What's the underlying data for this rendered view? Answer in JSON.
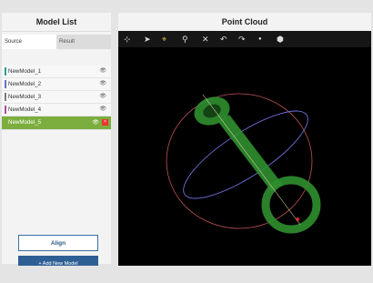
{
  "model_list": {
    "title": "Model List",
    "tabs": [
      {
        "label": "Source",
        "active": true
      },
      {
        "label": "Result",
        "active": false
      }
    ],
    "items": [
      {
        "name": "NewModel_1",
        "color": "#2aa198",
        "selected": false
      },
      {
        "name": "NewModel_2",
        "color": "#6c71c4",
        "selected": false
      },
      {
        "name": "NewModel_3",
        "color": "#7c7c7c",
        "selected": false
      },
      {
        "name": "NewModel_4",
        "color": "#b04aa8",
        "selected": false
      },
      {
        "name": "NewModel_5",
        "color": "#7cae3f",
        "selected": true
      }
    ],
    "visibility_glyph": "👁",
    "delete_glyph": "×",
    "align_label": "Align",
    "add_label": "+ Add New Model"
  },
  "point_cloud": {
    "title": "Point Cloud",
    "tools": [
      {
        "name": "pan-icon",
        "glyph": "⊹"
      },
      {
        "name": "select-icon",
        "glyph": "➤"
      },
      {
        "name": "point-pick-icon",
        "glyph": "⌖"
      },
      {
        "name": "measure-icon",
        "glyph": "⚲"
      },
      {
        "name": "close-icon",
        "glyph": "✕"
      },
      {
        "name": "undo-icon",
        "glyph": "↶"
      },
      {
        "name": "redo-icon",
        "glyph": "↷"
      },
      {
        "name": "dot-icon",
        "glyph": "●"
      },
      {
        "name": "cube-icon",
        "glyph": "⬢"
      }
    ],
    "colors": {
      "cloud": "#2f8f2f",
      "ring_red": "#c05555",
      "ring_blue": "#7070d8",
      "axis": "#cfcf9f"
    }
  }
}
